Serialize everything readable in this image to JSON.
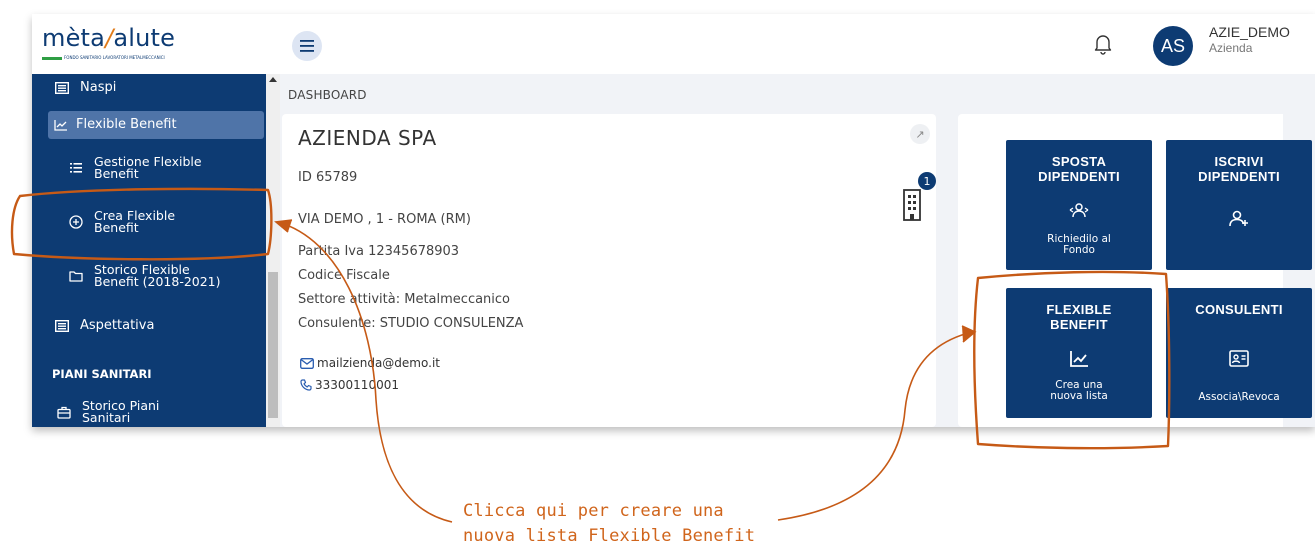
{
  "header": {
    "logo_main": "mèta",
    "logo_slash": "/",
    "logo_tail": "alute",
    "logo_subtitle": "FONDO SANITARIO LAVORATORI METALMECCANICI",
    "avatar_initials": "AS",
    "user_name": "AZIE_DEMO",
    "user_role": "Azienda"
  },
  "sidebar": {
    "items": [
      {
        "label": "Naspi"
      },
      {
        "label": "Flexible Benefit"
      },
      {
        "label_line1": "Gestione Flexible",
        "label_line2": "Benefit"
      },
      {
        "label_line1": "Crea Flexible",
        "label_line2": "Benefit"
      },
      {
        "label_line1": "Storico Flexible",
        "label_line2": "Benefit (2018-2021)"
      },
      {
        "label": "Aspettativa"
      },
      {
        "label_line1": "Storico Piani",
        "label_line2": "Sanitari"
      }
    ],
    "section_label": "PIANI SANITARI"
  },
  "breadcrumb": "DASHBOARD",
  "company": {
    "name": "AZIENDA SPA",
    "id": "ID 65789",
    "address": "VIA DEMO , 1 - ROMA (RM)",
    "partita_iva": "Partita Iva 12345678903",
    "codice_fiscale": "Codice Fiscale",
    "settore": "Settore attività: Metalmeccanico",
    "consulente": "Consulente: STUDIO CONSULENZA",
    "email": "mailzienda@demo.it",
    "phone": "33300110001",
    "notification_count": "1"
  },
  "tiles": [
    {
      "title_line1": "SPOSTA",
      "title_line2": "DIPENDENTI",
      "sub_line1": "Richiedilo al",
      "sub_line2": "Fondo",
      "icon": "users-swap-icon"
    },
    {
      "title_line1": "ISCRIVI",
      "title_line2": "DIPENDENTI",
      "sub_line1": "",
      "sub_line2": "",
      "icon": "user-add-icon"
    },
    {
      "title_line1": "FLEXIBLE",
      "title_line2": "BENEFIT",
      "sub_line1": "Crea una",
      "sub_line2": "nuova lista",
      "icon": "chart-icon"
    },
    {
      "title_line1": "CONSULENTI",
      "title_line2": "",
      "sub_line1": "Associa\\Revoca",
      "sub_line2": "",
      "icon": "id-card-icon"
    }
  ],
  "annotation": {
    "line1": "Clicca qui per creare una",
    "line2": "nuova lista Flexible Benefit"
  },
  "colors": {
    "navy": "#0d3b73",
    "accent_orange": "#d0651c",
    "active_item": "#4f74a8"
  }
}
